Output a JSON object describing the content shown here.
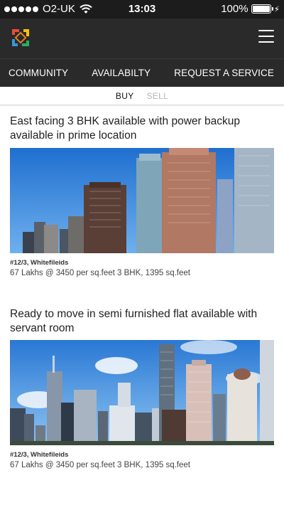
{
  "status_bar": {
    "carrier": "O2-UK",
    "time": "13:03",
    "battery": "100%",
    "signal_bars": 5,
    "battery_level": 1.0
  },
  "header": {
    "logo_icon": "app-logo-icon",
    "menu_icon": "hamburger-menu-icon"
  },
  "nav": {
    "tabs": [
      {
        "label": "COMMUNITY"
      },
      {
        "label": "AVAILABILTY"
      },
      {
        "label": "REQUEST A SERVICE"
      }
    ],
    "active_tab": "AVAILABILTY"
  },
  "sub_tabs": {
    "buy": "BUY",
    "sell": "SELL",
    "active": "BUY"
  },
  "listings": [
    {
      "title": "East facing 3 BHK available with power backup available in prime location",
      "location": "#12/3, Whitefileids",
      "details": "67 Lakhs @ 3450 per sq.feet 3 BHK, 1395 sq.feet",
      "image": "city-skyline-photo"
    },
    {
      "title": "Ready to move in semi furnished flat available with servant room",
      "location": "#12/3, Whitefileids",
      "details": "67 Lakhs @ 3450 per sq.feet 3 BHK, 1395 sq.feet",
      "image": "city-skyline-photo"
    }
  ],
  "colors": {
    "header_bg": "#2a2a2a",
    "status_bg": "#1c1c1c",
    "sky_blue": "#2f7fd8"
  }
}
